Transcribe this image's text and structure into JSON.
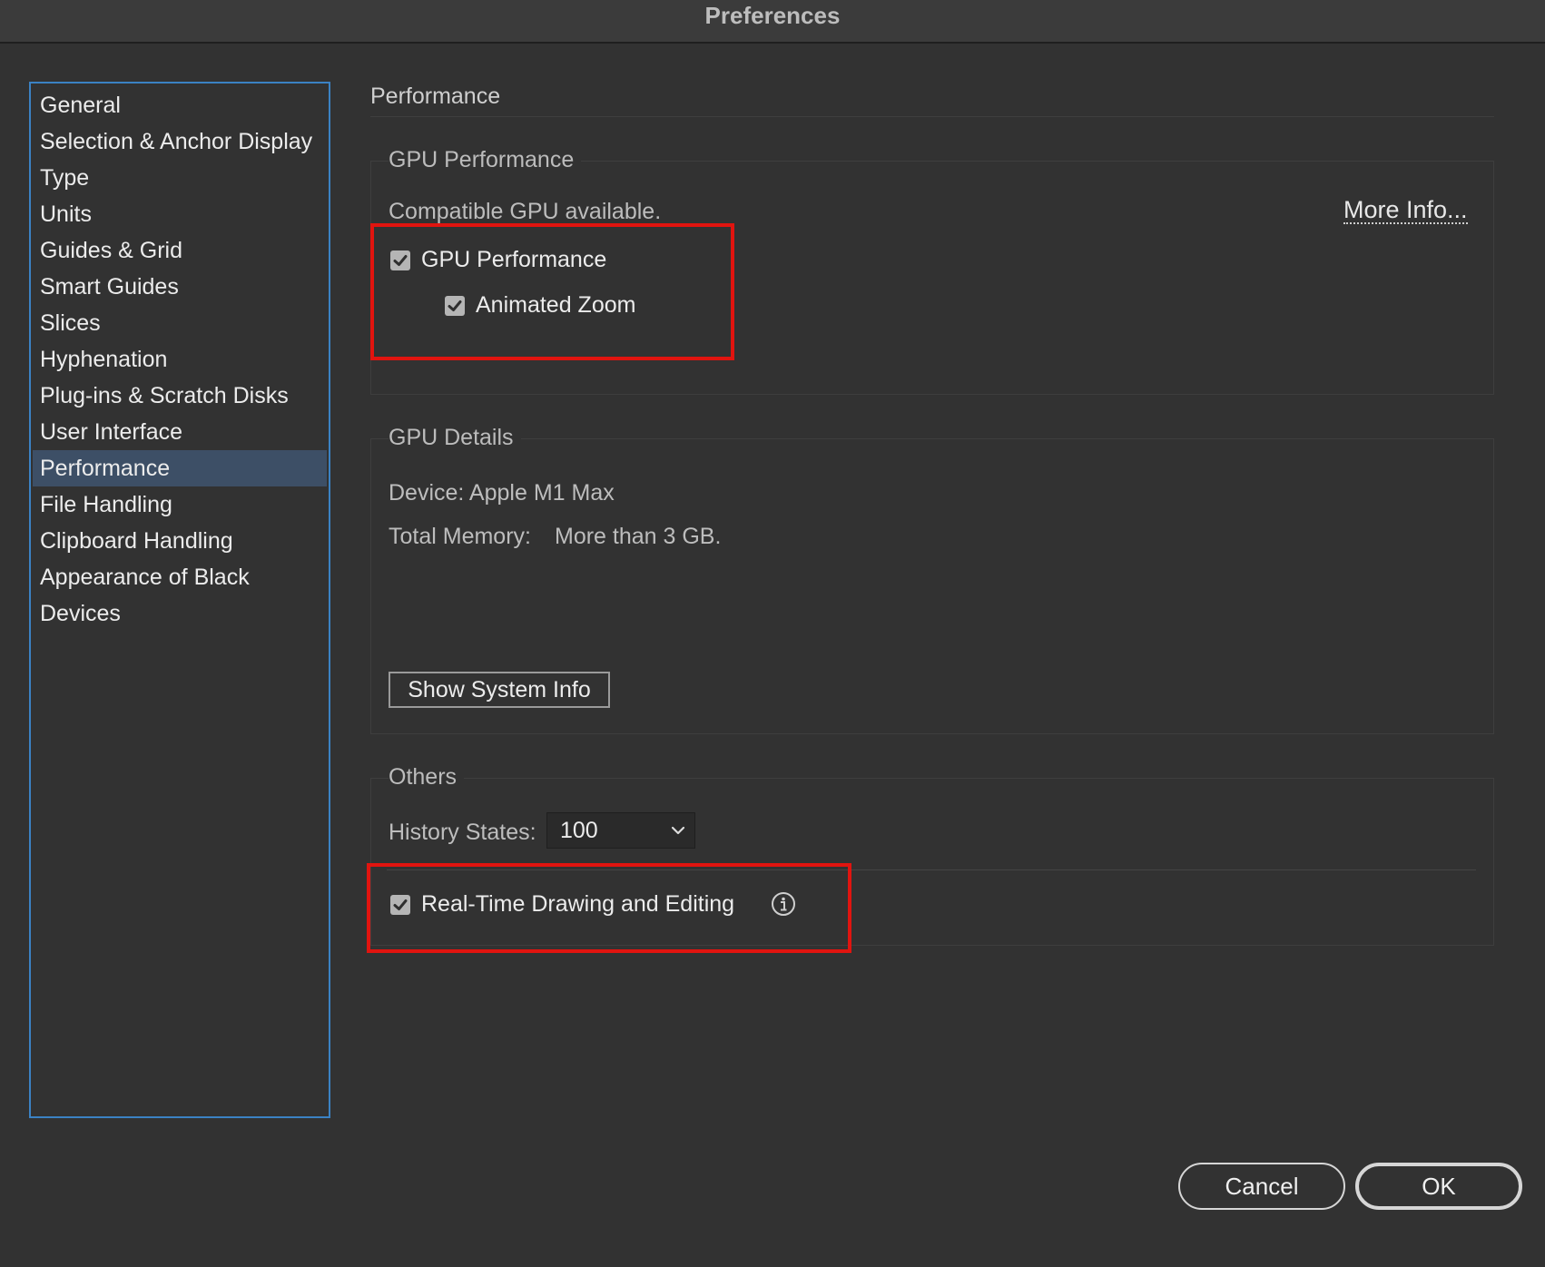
{
  "window": {
    "title": "Preferences"
  },
  "sidebar": {
    "items": [
      {
        "label": "General"
      },
      {
        "label": "Selection & Anchor Display"
      },
      {
        "label": "Type"
      },
      {
        "label": "Units"
      },
      {
        "label": "Guides & Grid"
      },
      {
        "label": "Smart Guides"
      },
      {
        "label": "Slices"
      },
      {
        "label": "Hyphenation"
      },
      {
        "label": "Plug-ins & Scratch Disks"
      },
      {
        "label": "User Interface"
      },
      {
        "label": "Performance"
      },
      {
        "label": "File Handling"
      },
      {
        "label": "Clipboard Handling"
      },
      {
        "label": "Appearance of Black"
      },
      {
        "label": "Devices"
      }
    ],
    "selected": "Performance"
  },
  "main": {
    "title": "Performance",
    "gpu_performance": {
      "group_label": "GPU Performance",
      "status": "Compatible GPU available.",
      "more_info": "More Info...",
      "gpu_checkbox": {
        "label": "GPU Performance",
        "checked": true
      },
      "zoom_checkbox": {
        "label": "Animated Zoom",
        "checked": true
      }
    },
    "gpu_details": {
      "group_label": "GPU Details",
      "device": "Device: Apple M1 Max",
      "memory_label": "Total Memory:",
      "memory_value": "More than 3 GB.",
      "system_info_button": "Show System Info"
    },
    "others": {
      "group_label": "Others",
      "history_label": "History States:",
      "history_value": "100",
      "realtime_checkbox": {
        "label": "Real-Time Drawing and Editing",
        "checked": true
      }
    }
  },
  "footer": {
    "cancel_label": "Cancel",
    "ok_label": "OK"
  },
  "colors": {
    "background": "#323232",
    "selection": "#3d4f66",
    "sidebar_border": "#3b82c4",
    "highlight": "#e1140f"
  }
}
